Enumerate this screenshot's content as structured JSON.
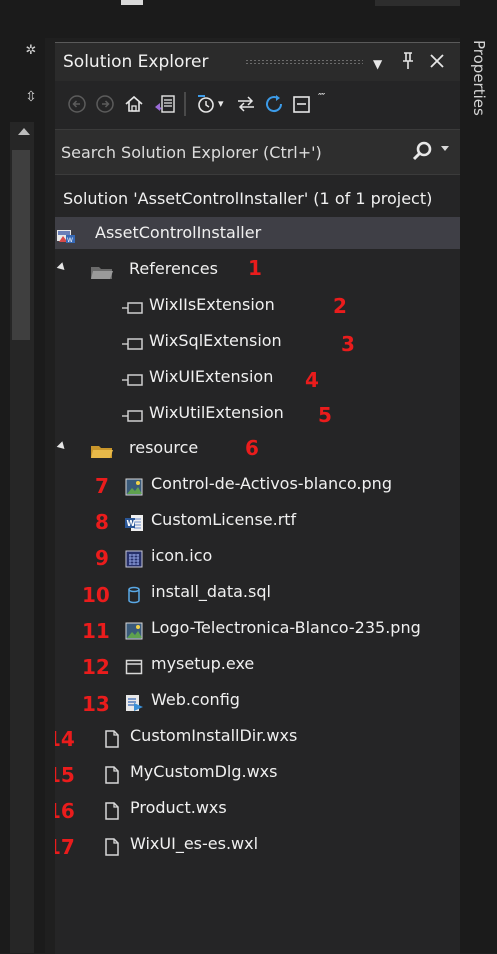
{
  "panel": {
    "title": "Solution Explorer",
    "pin_glyph": "↓",
    "pushpin_glyph": "$",
    "close_glyph": "✕",
    "side_tab": "Properties"
  },
  "search": {
    "placeholder": "Search Solution Explorer (Ctrl+')"
  },
  "solution": {
    "label": "Solution 'AssetControlInstaller' (1 of 1 project)"
  },
  "project": {
    "name": "AssetControlInstaller"
  },
  "tree": {
    "references": {
      "label": "References",
      "marker": "1",
      "items": [
        {
          "label": "WixIIsExtension",
          "marker": "2"
        },
        {
          "label": "WixSqlExtension",
          "marker": "3"
        },
        {
          "label": "WixUIExtension",
          "marker": "4"
        },
        {
          "label": "WixUtilExtension",
          "marker": "5"
        }
      ]
    },
    "resource": {
      "label": "resource",
      "marker": "6",
      "items": [
        {
          "label": "Control-de-Activos-blanco.png",
          "marker": "7",
          "icon": "image-icon"
        },
        {
          "label": "CustomLicense.rtf",
          "marker": "8",
          "icon": "word-doc-icon"
        },
        {
          "label": "icon.ico",
          "marker": "9",
          "icon": "ico-file-icon"
        },
        {
          "label": "install_data.sql",
          "marker": "10",
          "icon": "database-icon"
        },
        {
          "label": "Logo-Telectronica-Blanco-235.png",
          "marker": "11",
          "icon": "image-icon"
        },
        {
          "label": "mysetup.exe",
          "marker": "12",
          "icon": "exe-window-icon"
        },
        {
          "label": "Web.config",
          "marker": "13",
          "icon": "config-file-icon"
        }
      ]
    },
    "files": [
      {
        "label": "CustomInstallDir.wxs",
        "marker": "14"
      },
      {
        "label": "MyCustomDlg.wxs",
        "marker": "15"
      },
      {
        "label": "Product.wxs",
        "marker": "16"
      },
      {
        "label": "WixUI_es-es.wxl",
        "marker": "17"
      }
    ]
  }
}
